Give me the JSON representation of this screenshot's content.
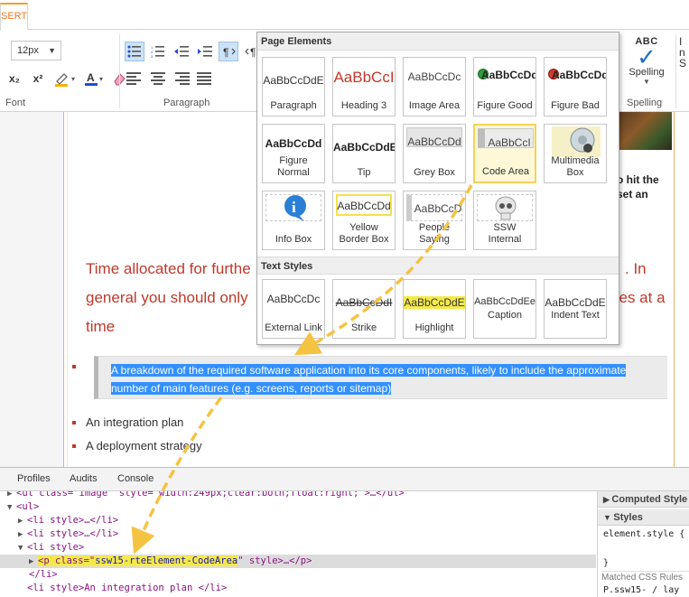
{
  "ribbon": {
    "tab_insert": "SERT",
    "font_size": "12px",
    "font_group_label": "Font",
    "paragraph_group_label": "Paragraph",
    "spelling_group_label": "Spelling",
    "spelling_button": {
      "abc": "ABC",
      "label": "Spelling"
    },
    "edge_text": "I\nn\nS",
    "icons": [
      "subscript-icon",
      "superscript-icon",
      "highlight-color-icon",
      "font-color-icon",
      "clear-format-icon",
      "bullet-list-icon",
      "numbered-list-icon",
      "outdent-icon",
      "indent-icon",
      "ltr-icon",
      "rtl-icon",
      "align-left-icon",
      "align-center-icon",
      "align-right-icon",
      "justify-icon"
    ],
    "subscript": "x₂",
    "superscript": "x²"
  },
  "editor": {
    "side_text": "o hit the\nset an",
    "red_line1_left": "Time allocated for furthe",
    "red_line1_right": ". In",
    "red_line2_left": "general you should only",
    "red_line2_right": "ses at a",
    "red_line3": "time",
    "code_area_text": "A breakdown of the required software application into its core components, likely to include the approximate number of main features (e.g. screens, reports or sitemap)",
    "list_items": [
      "An integration plan",
      "A deployment strategy"
    ]
  },
  "popup": {
    "page_elements_header": "Page Elements",
    "text_styles_header": "Text Styles",
    "page_elements": [
      {
        "sample": "AaBbCcDdE",
        "name": "Paragraph"
      },
      {
        "sample": "AaBbCcI",
        "name": "Heading 3"
      },
      {
        "sample": "AaBbCcDc",
        "name": "Image Area"
      },
      {
        "sample": "AaBbCcDd",
        "name": "Figure Good"
      },
      {
        "sample": "AaBbCcDd",
        "name": "Figure Bad"
      },
      {
        "sample": "AaBbCcDd",
        "name": "Figure Normal"
      },
      {
        "sample": "AaBbCcDdE",
        "name": "Tip"
      },
      {
        "sample": "AaBbCcDd",
        "name": "Grey Box"
      },
      {
        "sample": "AaBbCcI",
        "name": "Code Area"
      },
      {
        "sample": "",
        "name": "Multimedia Box"
      },
      {
        "sample": "",
        "name": "Info Box"
      },
      {
        "sample": "AaBbCcDd",
        "name": "Yellow Border Box"
      },
      {
        "sample": "AaBbCcD",
        "name": "People Saying"
      },
      {
        "sample": "",
        "name": "SSW Internal"
      }
    ],
    "text_styles": [
      {
        "sample": "AaBbCcDc",
        "name": "External Link"
      },
      {
        "sample": "AaBbCcDdI",
        "name": "Strike"
      },
      {
        "sample": "AaBbCcDdE",
        "name": "Highlight"
      },
      {
        "sample": "AaBbCcDdEe",
        "name": "Caption"
      },
      {
        "sample": "AaBbCcDdE",
        "name": "Indent Text"
      }
    ],
    "selected_tile": "Code Area"
  },
  "devtools": {
    "tabs": [
      "Profiles",
      "Audits",
      "Console"
    ],
    "dom": {
      "line0": "<ul class=\"image\" style=\"width:249px;clear:both;float:right;\">…</ul>",
      "line1": "<ul>",
      "line2": "<li style>…</li>",
      "line3": "<li style>…</li>",
      "line4": "<li style>",
      "line5_pre": "<p class=\"",
      "line5_cls": "ssw15-rteElement-CodeArea",
      "line5_post": "\" style>…</p>",
      "line6": "</li>",
      "line7": "<li style>An integration plan </li>"
    },
    "styles_pane": {
      "computed": "Computed Style",
      "styles": "Styles",
      "element_style": "element.style {",
      "closing_brace": "}",
      "matched": "Matched CSS Rules",
      "rule": "P.ssw15- / lay"
    }
  },
  "colors": {
    "accent_orange": "#f07820",
    "selection_blue": "#3390ff",
    "heading_red": "#c0392b",
    "callout_arrow": "#f5c342",
    "highlight_yellow": "#f5e94a"
  }
}
